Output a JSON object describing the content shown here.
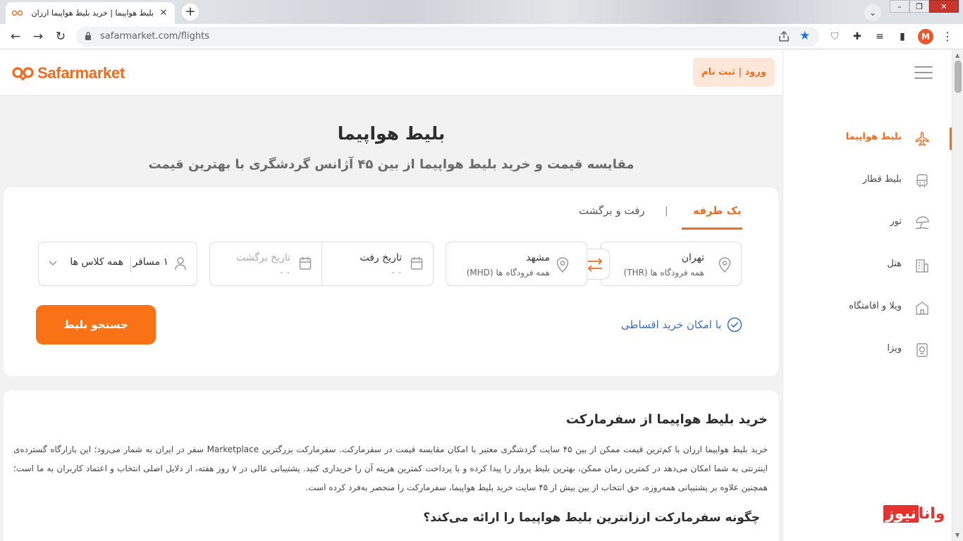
{
  "browser": {
    "tab_title": "بلیط هواپیما | خرید بلیط هواپیما ارزان از بی",
    "url": "safarmarket.com/flights",
    "profile_initial": "M"
  },
  "header": {
    "logo_text": "Safarmarket",
    "login_label": "ورود | ثبت نام"
  },
  "sidebar": {
    "items": [
      {
        "label": "بلیط هواپیما",
        "icon": "airplane-icon",
        "active": true
      },
      {
        "label": "بلیط قطار",
        "icon": "train-icon",
        "active": false
      },
      {
        "label": "تور",
        "icon": "beach-umbrella-icon",
        "active": false
      },
      {
        "label": "هتل",
        "icon": "hotel-icon",
        "active": false
      },
      {
        "label": "ویلا و اقامتگاه",
        "icon": "villa-icon",
        "active": false
      },
      {
        "label": "ویزا",
        "icon": "passport-icon",
        "active": false
      }
    ]
  },
  "hero": {
    "title": "بلیط هواپیما",
    "subtitle": "مقایسه قیمت و خرید بلیط هواپیما از بین ۴۵ آژانس گردشگری با بهترین قیمت"
  },
  "search": {
    "tabs": {
      "one_way": "یک طرفه",
      "round_trip": "رفت و برگشت",
      "separator": "|"
    },
    "origin": {
      "city": "تهران",
      "airport": "همه فرودگاه ها (THR)"
    },
    "destination": {
      "city": "مشهد",
      "airport": "همه فرودگاه ها (MHD)"
    },
    "depart": {
      "label": "تاریخ رفت",
      "value": "- -"
    },
    "return": {
      "label": "تاریخ برگشت",
      "value": "- -"
    },
    "passengers": "۱ مسافر",
    "cabin_class": "همه کلاس ها",
    "installment": "با امکان خرید اقساطی",
    "submit": "جستجو بلیط"
  },
  "content": {
    "title": "خرید بلیط هواپیما از سفرمارکت",
    "paragraph": "خرید بلیط هواپیما ارزان با کم‌ترین قیمت ممکن از بین ۴۵ سایت گردشگری معتبر با امکان مقایسه قیمت در سفرمارکت. سفرمارکت بزرگترین Marketplace سفر در ایران به شمار می‌رود؛ این بازارگاه گسترده‌ی اینترنتی به شما امکان می‌دهد در کمترین زمان ممکن، بهترین بلیط پرواز را پیدا کرده و با پرداخت کمترین هزینه آن را خریداری کنید. پشتیبانی عالی در ۷ روز هفته، از دلایل اصلی انتخاب و اعتماد کاربران به ما است؛ همچنین علاوه بر پشتیبانی همه‌روزه، حق انتخاب از بین بیش از ۴۵ سایت خرید بلیط هواپیما، سفرمارکت را منحصر به‌فرد کرده است.",
    "subheading": "چگونه سفرمارکت ارزانترین بلیط هواپیما را ارائه می‌کند؟"
  },
  "watermark": {
    "part_a": "وانا",
    "part_b": "نیوز"
  },
  "colors": {
    "brand": "#f26b1d",
    "button": "#f97316",
    "link": "#3a6fc4"
  }
}
